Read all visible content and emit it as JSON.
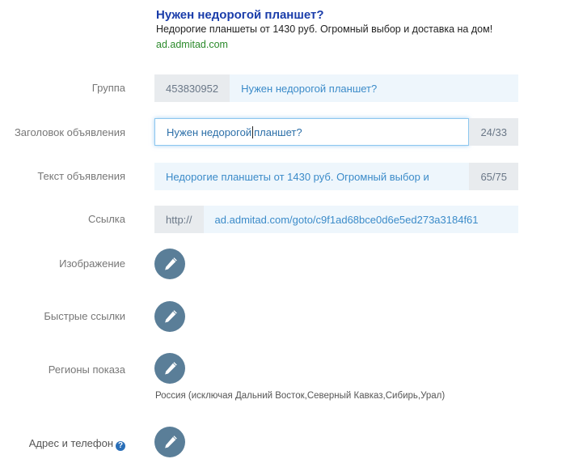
{
  "preview": {
    "title": "Нужен недорогой планшет?",
    "text": "Недорогие планшеты от 1430 руб. Огромный выбор и доставка на дом!",
    "url": "ad.admitad.com"
  },
  "form": {
    "group": {
      "label": "Группа",
      "id": "453830952",
      "value": "Нужен недорогой планшет?"
    },
    "headline": {
      "label": "Заголовок объявления",
      "value_before_caret": "Нужен недорогой ",
      "value_after_caret": "планшет?",
      "counter": "24/33"
    },
    "ad_text": {
      "label": "Текст объявления",
      "value": "Недорогие планшеты от 1430 руб. Огромный выбор и",
      "counter": "65/75"
    },
    "link": {
      "label": "Ссылка",
      "protocol": "http://",
      "value": "ad.admitad.com/goto/c9f1ad68bce0d6e5ed273a3184f61"
    },
    "image": {
      "label": "Изображение"
    },
    "quick_links": {
      "label": "Быстрые ссылки"
    },
    "regions": {
      "label": "Регионы показа",
      "note": "Россия (исключая Дальний Восток,Северный Кавказ,Сибирь,Урал)"
    },
    "contacts": {
      "label": "Адрес и телефон",
      "help_glyph": "?"
    }
  },
  "icons": {
    "edit": "pencil-icon",
    "help": "question-circle-icon"
  },
  "colors": {
    "accent": "#5a7e98",
    "link_blue": "#3b8bc9",
    "title_blue": "#1a3daa",
    "url_green": "#2b8a2b"
  }
}
